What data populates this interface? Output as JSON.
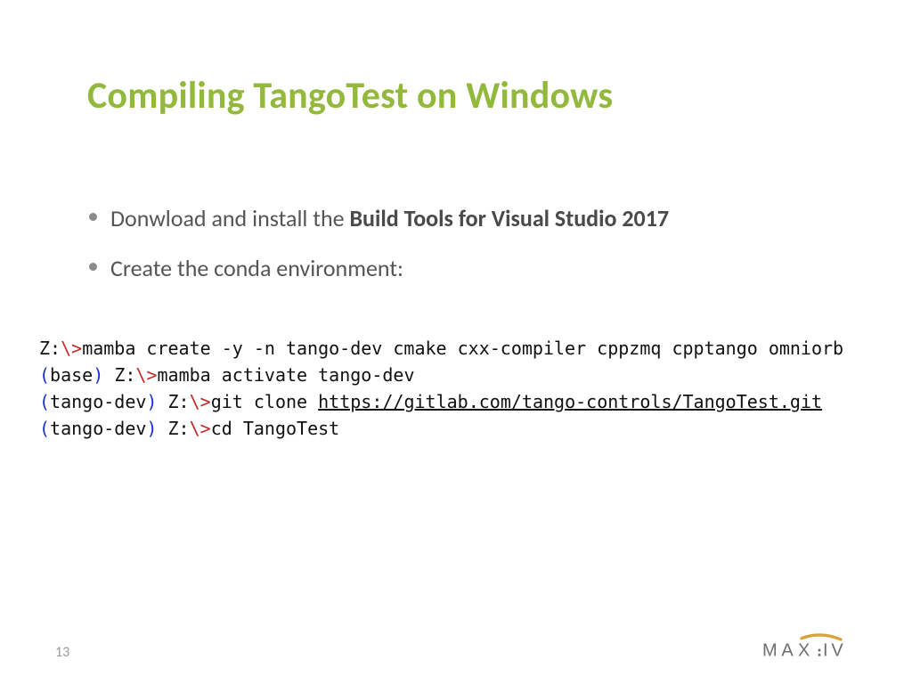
{
  "title": "Compiling TangoTest on Windows",
  "bullets": [
    {
      "pre": "Donwload and install the ",
      "bold": "Build Tools for Visual Studio 2017",
      "post": ""
    },
    {
      "pre": "Create the conda environment:",
      "bold": "",
      "post": ""
    }
  ],
  "code": {
    "line1": {
      "drive": "Z:",
      "prompt": "\\>",
      "cmd": "mamba create -y -n tango-dev cmake cxx-compiler cppzmq cpptango omniorb"
    },
    "line2": {
      "env_paren_l": "(",
      "env": "base",
      "env_paren_r": ")",
      "space": " ",
      "drive": "Z:",
      "prompt": "\\>",
      "cmd": "mamba activate tango-dev"
    },
    "line3": {
      "env_paren_l": "(",
      "env": "tango-dev",
      "env_paren_r": ")",
      "space": " ",
      "drive": "Z:",
      "prompt": "\\>",
      "cmd_pre": "git clone ",
      "url": "https://gitlab.com/tango-controls/TangoTest.git"
    },
    "line4": {
      "env_paren_l": "(",
      "env": "tango-dev",
      "env_paren_r": ")",
      "space": " ",
      "drive": "Z:",
      "prompt": "\\>",
      "cmd": "cd TangoTest"
    }
  },
  "pagenum": "13",
  "logo_text": "MAX IV"
}
